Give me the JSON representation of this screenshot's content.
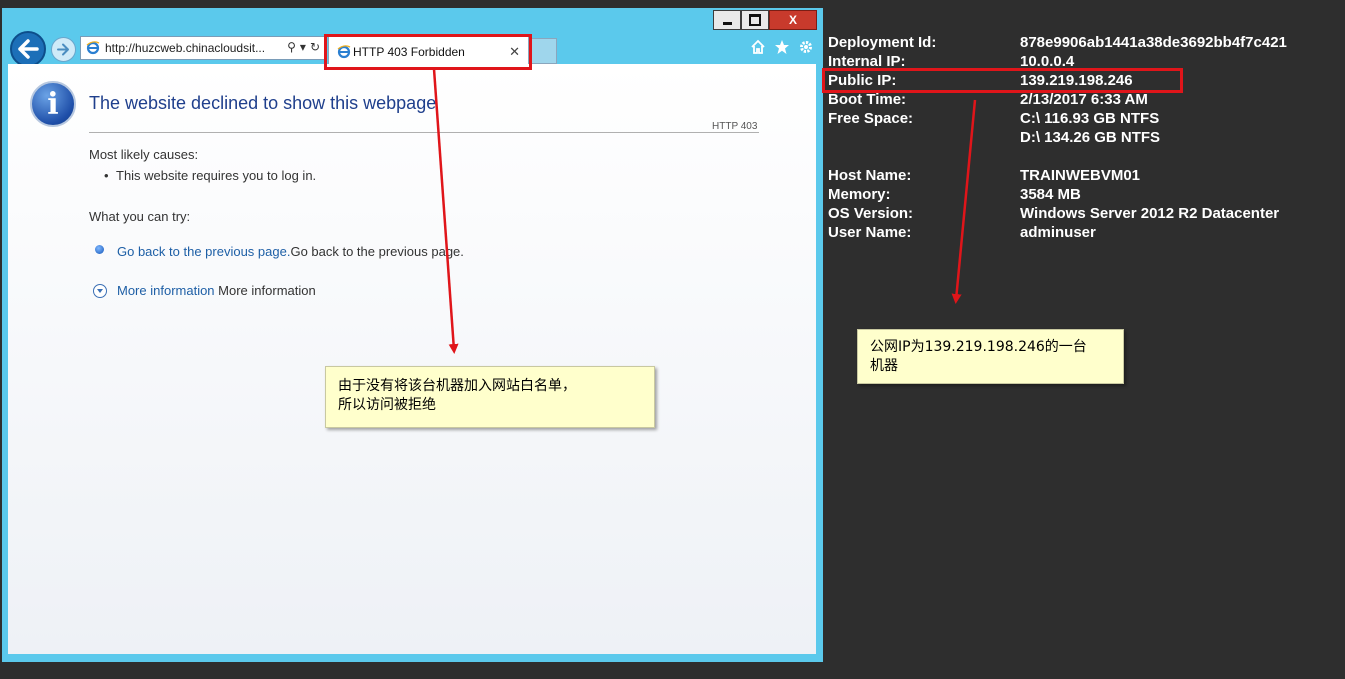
{
  "browser": {
    "address_url": "http://huzcweb.chinacloudsit...",
    "tab_title": "HTTP 403 Forbidden",
    "caption": {
      "min": "",
      "max": "",
      "close": "X"
    }
  },
  "page": {
    "title": "The website declined to show this webpage",
    "http_code": "HTTP 403",
    "causes_heading": "Most likely causes:",
    "causes": [
      "This website requires you to log in."
    ],
    "try_heading": "What you can try:",
    "back_link": "Go back to the previous page.",
    "back_text": "Go back to the previous page.",
    "more_link": "More information",
    "more_text": "More information"
  },
  "sysinfo": [
    {
      "label": "Deployment Id:",
      "value": "878e9906ab1441a38de3692bb4f7c421"
    },
    {
      "label": "Internal IP:",
      "value": "10.0.0.4"
    },
    {
      "label": "Public IP:",
      "value": "139.219.198.246"
    },
    {
      "label": "Boot Time:",
      "value": "2/13/2017 6:33 AM"
    },
    {
      "label": "Free Space:",
      "value": "C:\\ 116.93 GB NTFS"
    },
    {
      "label": "",
      "value": "D:\\ 134.26 GB NTFS"
    },
    {
      "label": "",
      "value": ""
    },
    {
      "label": "Host Name:",
      "value": "TRAINWEBVM01"
    },
    {
      "label": "Memory:",
      "value": "3584 MB"
    },
    {
      "label": "OS Version:",
      "value": "Windows Server 2012 R2 Datacenter"
    },
    {
      "label": "User Name:",
      "value": "adminuser"
    }
  ],
  "annotations": {
    "left_note_line1": "由于没有将该台机器加入网站白名单，",
    "left_note_line2": "所以访问被拒绝",
    "right_note_line1": "公网IP为139.219.198.246的一台",
    "right_note_line2": "机器"
  },
  "colors": {
    "highlight_red": "#e0151a",
    "callout_yellow": "#ffffcc",
    "window_frame": "#5bc9ec",
    "link_blue": "#1e5fa6"
  },
  "icons": [
    "back-arrow-icon",
    "forward-arrow-icon",
    "ie-logo-icon",
    "search-icon",
    "refresh-icon",
    "tab-close-icon",
    "home-icon",
    "favorites-star-icon",
    "gear-icon",
    "info-icon",
    "bullet-icon",
    "expand-chevron-icon"
  ]
}
